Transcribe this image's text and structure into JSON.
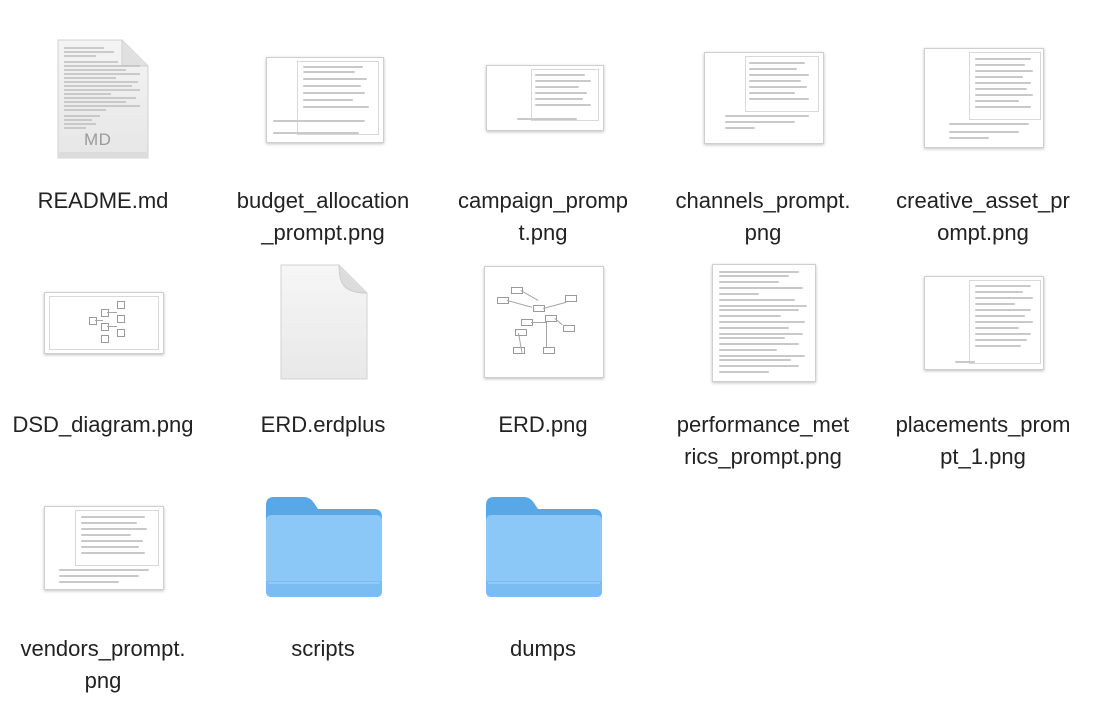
{
  "files": [
    {
      "name": "README.md",
      "kind": "markdown",
      "badge": "MD"
    },
    {
      "name": "budget_allocation_prompt.png",
      "kind": "image-text"
    },
    {
      "name": "campaign_prompt.png",
      "kind": "image-text"
    },
    {
      "name": "channels_prompt.png",
      "kind": "image-text"
    },
    {
      "name": "creative_asset_prompt.png",
      "kind": "image-text"
    },
    {
      "name": "DSD_diagram.png",
      "kind": "image-diagram"
    },
    {
      "name": "ERD.erdplus",
      "kind": "generic-document"
    },
    {
      "name": "ERD.png",
      "kind": "image-diagram"
    },
    {
      "name": "performance_metrics_prompt.png",
      "kind": "image-text"
    },
    {
      "name": "placements_prompt_1.png",
      "kind": "image-text"
    },
    {
      "name": "vendors_prompt.png",
      "kind": "image-text"
    },
    {
      "name": "scripts",
      "kind": "folder"
    },
    {
      "name": "dumps",
      "kind": "folder"
    }
  ],
  "labels": {
    "readme": [
      "README.md"
    ],
    "budget": [
      "budget_allocation",
      "_prompt.png"
    ],
    "campaign": [
      "campaign_promp",
      "t.png"
    ],
    "channels": [
      "channels_prompt.",
      "png"
    ],
    "creative": [
      "creative_asset_pr",
      "ompt.png"
    ],
    "dsd": [
      "DSD_diagram.png"
    ],
    "erdplus": [
      "ERD.erdplus"
    ],
    "erdpng": [
      "ERD.png"
    ],
    "performance": [
      "performance_met",
      "rics_prompt.png"
    ],
    "placements": [
      "placements_prom",
      "pt_1.png"
    ],
    "vendors": [
      "vendors_prompt.",
      "png"
    ],
    "scripts": [
      "scripts"
    ],
    "dumps": [
      "dumps"
    ]
  },
  "colors": {
    "folder_back": "#5aa7e6",
    "folder_front": "#8cc8f7",
    "folder_front_bottom": "#6fb6ef"
  },
  "icons": {
    "readme": "markdown-document-icon",
    "erdplus": "blank-document-icon",
    "folders": "folder-icon"
  }
}
